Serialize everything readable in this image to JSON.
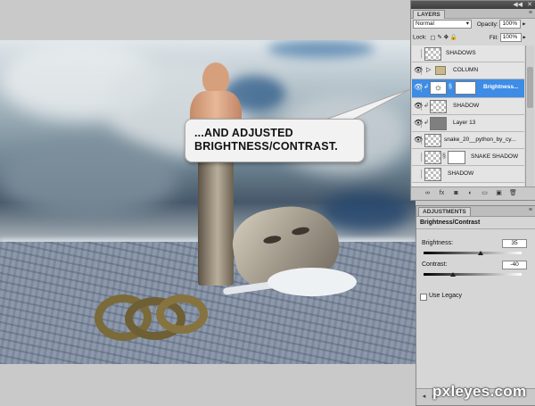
{
  "callout": {
    "text": "...AND ADJUSTED BRIGHTNESS/CONTRAST."
  },
  "layers_panel": {
    "tab_label": "LAYERS",
    "blend_mode": "Normal",
    "opacity_label": "Opacity:",
    "opacity_value": "100%",
    "lock_label": "Lock:",
    "fill_label": "Fill:",
    "fill_value": "100%",
    "items": [
      {
        "name": "SHADOWS",
        "visible": false,
        "type": "layer"
      },
      {
        "name": "COLUMN",
        "visible": true,
        "type": "group"
      },
      {
        "name": "Brightness...",
        "visible": true,
        "type": "adjustment",
        "selected": true
      },
      {
        "name": "SHADOW",
        "visible": true,
        "type": "layer"
      },
      {
        "name": "Layer 13",
        "visible": true,
        "type": "layer"
      },
      {
        "name": "snake_20__python_by_cy...",
        "visible": true,
        "type": "layer"
      },
      {
        "name": "SNAKE SHADOW",
        "visible": false,
        "type": "masked"
      },
      {
        "name": "SHADOW",
        "visible": false,
        "type": "layer"
      }
    ]
  },
  "adjustments_panel": {
    "tab_label": "ADJUSTMENTS",
    "title": "Brightness/Contrast",
    "brightness_label": "Brightness:",
    "brightness_value": "35",
    "brightness_fraction": 0.585,
    "contrast_label": "Contrast:",
    "contrast_value": "-40",
    "contrast_fraction": 0.3,
    "legacy_label": "Use Legacy"
  },
  "watermark": {
    "text": "pxleyes.com"
  },
  "colors": {
    "selection": "#3d8ce6",
    "panel_bg": "#d6d6d6",
    "titlebar": "#4a4a4a"
  },
  "icons": [
    "eye-icon",
    "folder-icon",
    "chain-link-icon",
    "brightness-adjustment-icon",
    "lock-icon",
    "link-layers-icon",
    "fx-icon",
    "mask-icon",
    "new-adjustment-icon",
    "new-group-icon",
    "new-layer-icon",
    "trash-icon"
  ]
}
